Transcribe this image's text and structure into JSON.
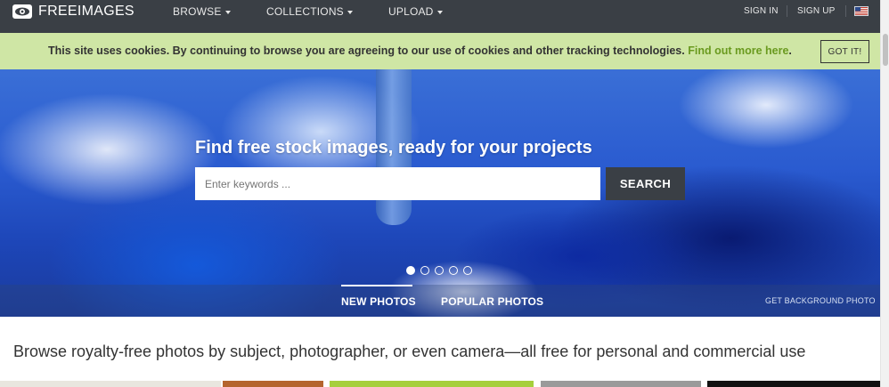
{
  "header": {
    "logo_text": "FREEIMAGES",
    "nav": [
      {
        "label": "BROWSE"
      },
      {
        "label": "COLLECTIONS"
      },
      {
        "label": "UPLOAD"
      }
    ],
    "sign_in": "SIGN IN",
    "sign_up": "SIGN UP",
    "flag_icon": "us-flag-icon"
  },
  "cookie": {
    "message": "This site uses cookies. By continuing to browse you are agreeing to our use of cookies and other tracking technologies.",
    "link_text": "Find out more here",
    "button_label": "GOT IT!"
  },
  "hero": {
    "title": "Find free stock images, ready for your projects",
    "search_placeholder": "Enter keywords ...",
    "search_button": "SEARCH",
    "slides_count": 5,
    "active_slide": 1,
    "tabs": [
      {
        "label": "NEW PHOTOS",
        "active": true
      },
      {
        "label": "POPULAR PHOTOS",
        "active": false
      }
    ],
    "get_background": "GET BACKGROUND PHOTO"
  },
  "main": {
    "tagline": "Browse royalty-free photos by subject, photographer, or even camera—all free for personal and commercial use"
  },
  "colors": {
    "nav_bg": "#3a3f45",
    "cookie_bg": "#cfe6a5",
    "cookie_link": "#6a9a1f",
    "search_button_bg": "#3a3f45"
  }
}
